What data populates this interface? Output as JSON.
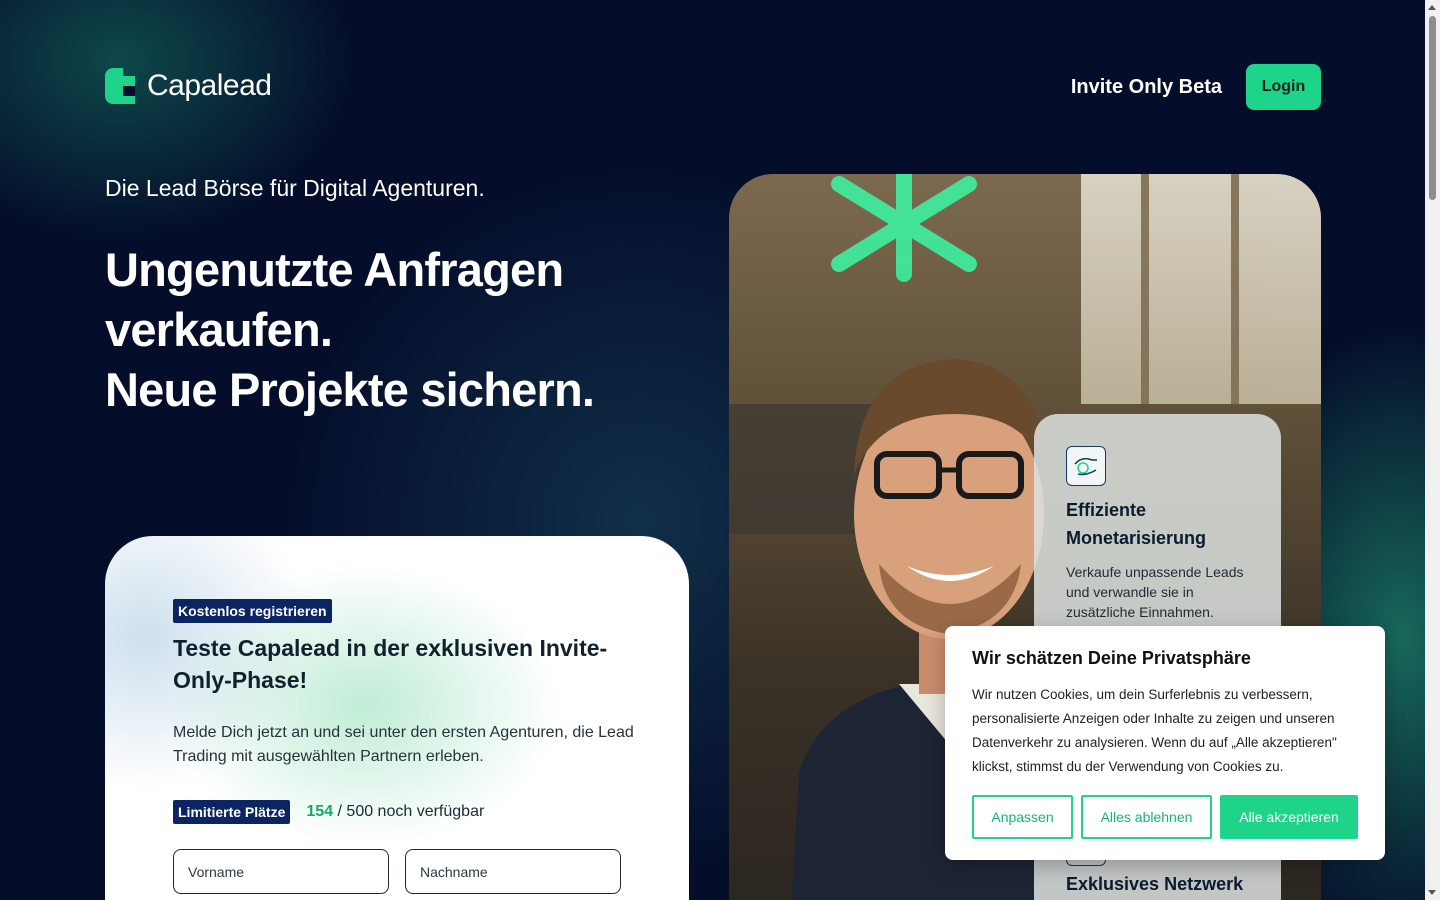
{
  "header": {
    "brand": "Capalead",
    "beta_label": "Invite Only Beta",
    "login_label": "Login"
  },
  "hero": {
    "tagline": "Die Lead Börse für Digital Agenturen.",
    "headline": [
      "Ungenutzte Anfragen",
      "verkaufen.",
      "Neue Projekte sichern."
    ]
  },
  "signup": {
    "badge": "Kostenlos registrieren",
    "title": "Teste Capalead in der exklusiven Invite-Only-Phase!",
    "description": "Melde Dich jetzt an und sei unter den ersten Agenturen, die Lead Trading mit ausgewählten Partnern erleben.",
    "spots_badge": "Limitierte Plätze",
    "spots_available": "154",
    "spots_rest": " / 500 noch verfügbar",
    "first_name_placeholder": "Vorname",
    "last_name_placeholder": "Nachname"
  },
  "features": [
    {
      "icon": "hand-coin-icon",
      "title": "Effiziente Monetarisierung",
      "text": "Verkaufe unpassende Leads und verwandle sie in zusätzliche Einnahmen."
    },
    {
      "icon": "network-icon",
      "title": "Exklusives Netzwerk"
    }
  ],
  "cookie": {
    "title": "Wir schätzen Deine Privatsphäre",
    "text": "Wir nutzen Cookies, um dein Surferlebnis zu verbessern, personalisierte Anzeigen oder Inhalte zu zeigen und unseren Datenverkehr zu analysieren. Wenn du auf „Alle akzeptieren\" klickst, stimmst du der Verwendung von Cookies zu.",
    "customize_label": "Anpassen",
    "reject_label": "Alles ablehnen",
    "accept_label": "Alle akzeptieren"
  },
  "colors": {
    "background": "#040d2a",
    "accent": "#1ed38a",
    "badge": "#0b2563",
    "spots_highlight": "#17a76a"
  }
}
